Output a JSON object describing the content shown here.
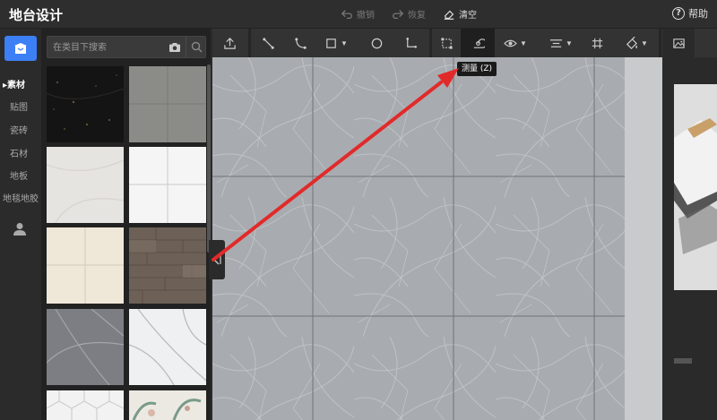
{
  "app": {
    "title": "地台设计"
  },
  "top_actions": {
    "undo": "撤销",
    "redo": "恢复",
    "clear": "清空",
    "help": "帮助"
  },
  "rail": {
    "items": [
      {
        "label": "▸素材"
      },
      {
        "label": "贴图"
      },
      {
        "label": "瓷砖"
      },
      {
        "label": "石材"
      },
      {
        "label": "地板"
      },
      {
        "label": "地毯地胶"
      }
    ]
  },
  "search": {
    "placeholder": "在类目下搜索"
  },
  "materials": [
    {
      "name": "black-marble",
      "color": "#151515"
    },
    {
      "name": "grey-tile",
      "color": "#8a8a87"
    },
    {
      "name": "light-stone",
      "color": "#e6e4e0"
    },
    {
      "name": "white-tile-grid",
      "color": "#f4f4f4"
    },
    {
      "name": "cream-tile-grid",
      "color": "#efe8da"
    },
    {
      "name": "wood-floor",
      "color": "#6e6258"
    },
    {
      "name": "grey-marble",
      "color": "#7b7d82"
    },
    {
      "name": "white-marble",
      "color": "#eef0f1"
    },
    {
      "name": "white-hex",
      "color": "#f1f1f1"
    },
    {
      "name": "floral-tile",
      "color": "#ece9e3"
    }
  ],
  "toolbar": {
    "tooltip": "测量 (Z)"
  },
  "colors": {
    "accent": "#3d7ff5",
    "arrow": "#e22a2a",
    "canvas_stone": "#a9adb1",
    "grout": "#6f7377"
  }
}
